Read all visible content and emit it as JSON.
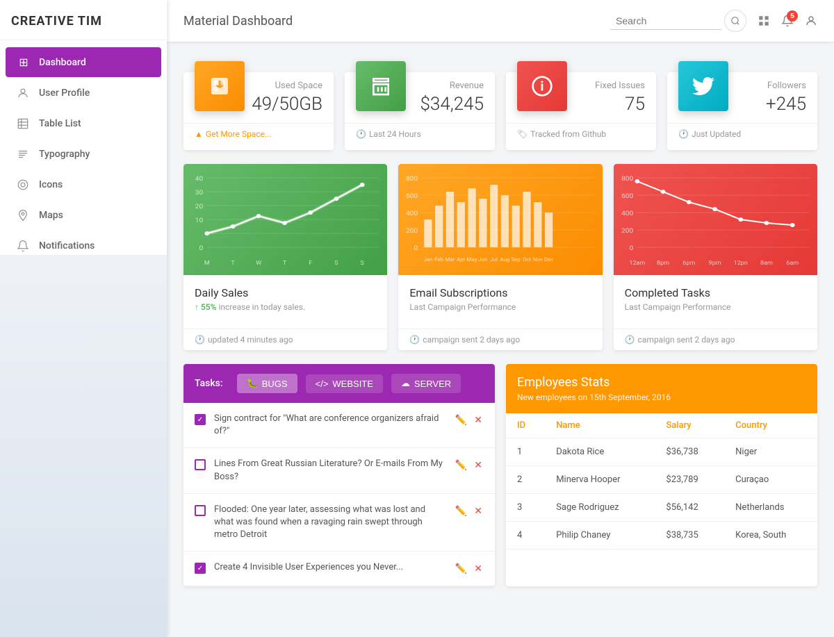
{
  "sidebar": {
    "logo": "CREATIVE TIM",
    "items": [
      {
        "id": "dashboard",
        "label": "Dashboard",
        "icon": "⊞",
        "active": true
      },
      {
        "id": "user-profile",
        "label": "User Profile",
        "icon": "👤",
        "active": false
      },
      {
        "id": "table-list",
        "label": "Table List",
        "icon": "📋",
        "active": false
      },
      {
        "id": "typography",
        "label": "Typography",
        "icon": "☰",
        "active": false
      },
      {
        "id": "icons",
        "label": "Icons",
        "icon": "⬡",
        "active": false
      },
      {
        "id": "maps",
        "label": "Maps",
        "icon": "📍",
        "active": false
      },
      {
        "id": "notifications",
        "label": "Notifications",
        "icon": "🔔",
        "active": false
      }
    ]
  },
  "header": {
    "title": "Material Dashboard",
    "search_placeholder": "Search",
    "notification_count": "5"
  },
  "stats": [
    {
      "id": "used-space",
      "icon": "⧉",
      "icon_bg": "#ff9800",
      "label": "Used Space",
      "value": "49/50GB",
      "footer_icon": "warn",
      "footer_text": "Get More Space...",
      "footer_color": "#ff9800"
    },
    {
      "id": "revenue",
      "icon": "🏪",
      "icon_bg": "#4caf50",
      "label": "Revenue",
      "value": "$34,245",
      "footer_icon": "clock",
      "footer_text": "Last 24 Hours",
      "footer_color": "#999"
    },
    {
      "id": "fixed-issues",
      "icon": "ℹ",
      "icon_bg": "#f44336",
      "label": "Fixed Issues",
      "value": "75",
      "footer_icon": "tag",
      "footer_text": "Tracked from Github",
      "footer_color": "#999"
    },
    {
      "id": "followers",
      "icon": "🐦",
      "icon_bg": "#00bcd4",
      "label": "Followers",
      "value": "+245",
      "footer_icon": "clock",
      "footer_text": "Just Updated",
      "footer_color": "#999"
    }
  ],
  "charts": [
    {
      "id": "daily-sales",
      "title": "Daily Sales",
      "subtitle": "55% increase in today sales.",
      "subtitle_color": "#4caf50",
      "footer": "updated 4 minutes ago",
      "bg_color": "#4caf50",
      "type": "line"
    },
    {
      "id": "email-subscriptions",
      "title": "Email Subscriptions",
      "subtitle": "Last Campaign Performance",
      "subtitle_color": "#999",
      "footer": "campaign sent 2 days ago",
      "bg_color": "#ff9800",
      "type": "bar"
    },
    {
      "id": "completed-tasks",
      "title": "Completed Tasks",
      "subtitle": "Last Campaign Performance",
      "subtitle_color": "#999",
      "footer": "campaign sent 2 days ago",
      "bg_color": "#f44336",
      "type": "line2"
    }
  ],
  "tasks": {
    "label": "Tasks:",
    "tabs": [
      {
        "id": "bugs",
        "label": "BUGS",
        "icon": "🐛",
        "active": true
      },
      {
        "id": "website",
        "label": "WEBSITE",
        "icon": "</>",
        "active": false
      },
      {
        "id": "server",
        "label": "SERVER",
        "icon": "☁",
        "active": false
      }
    ],
    "items": [
      {
        "id": 1,
        "text": "Sign contract for \"What are conference organizers afraid of?\"",
        "checked": true
      },
      {
        "id": 2,
        "text": "Lines From Great Russian Literature? Or E-mails From My Boss?",
        "checked": false
      },
      {
        "id": 3,
        "text": "Flooded: One year later, assessing what was lost and what was found when a ravaging rain swept through metro Detroit",
        "checked": false
      },
      {
        "id": 4,
        "text": "Create 4 Invisible User Experiences you Never...",
        "checked": true
      }
    ]
  },
  "employees": {
    "title": "Employees Stats",
    "subtitle": "New employees on 15th September, 2016",
    "columns": [
      "ID",
      "Name",
      "Salary",
      "Country"
    ],
    "rows": [
      {
        "id": "1",
        "name": "Dakota Rice",
        "salary": "$36,738",
        "country": "Niger"
      },
      {
        "id": "2",
        "name": "Minerva Hooper",
        "salary": "$23,789",
        "country": "Curaçao"
      },
      {
        "id": "3",
        "name": "Sage Rodriguez",
        "salary": "$56,142",
        "country": "Netherlands"
      },
      {
        "id": "4",
        "name": "Philip Chaney",
        "salary": "$38,735",
        "country": "Korea, South"
      }
    ]
  }
}
